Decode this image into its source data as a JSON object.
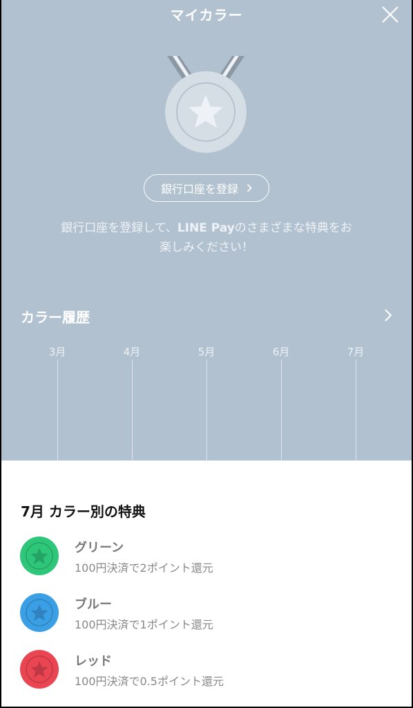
{
  "header": {
    "title": "マイカラー"
  },
  "register": {
    "button_label": "銀行口座を登録"
  },
  "description": {
    "line1_pre": "銀行口座を登録して、",
    "line1_bold": "LINE Pay",
    "line1_post": "のさまざまな特典をお",
    "line2": "楽しみください！"
  },
  "history": {
    "title": "カラー履歴",
    "months": [
      "3月",
      "4月",
      "5月",
      "6月",
      "7月"
    ]
  },
  "benefits": {
    "title": "7月 カラー別の特典",
    "items": [
      {
        "name": "グリーン",
        "desc": "100円決済で2ポイント還元",
        "color": "#2ec77a"
      },
      {
        "name": "ブルー",
        "desc": "100円決済で1ポイント還元",
        "color": "#3a9fe4"
      },
      {
        "name": "レッド",
        "desc": "100円決済で0.5ポイント還元",
        "color": "#e94552"
      }
    ]
  },
  "icons": [
    "close-icon",
    "medal-icon",
    "chevron-right-icon",
    "star-coin-icon"
  ]
}
